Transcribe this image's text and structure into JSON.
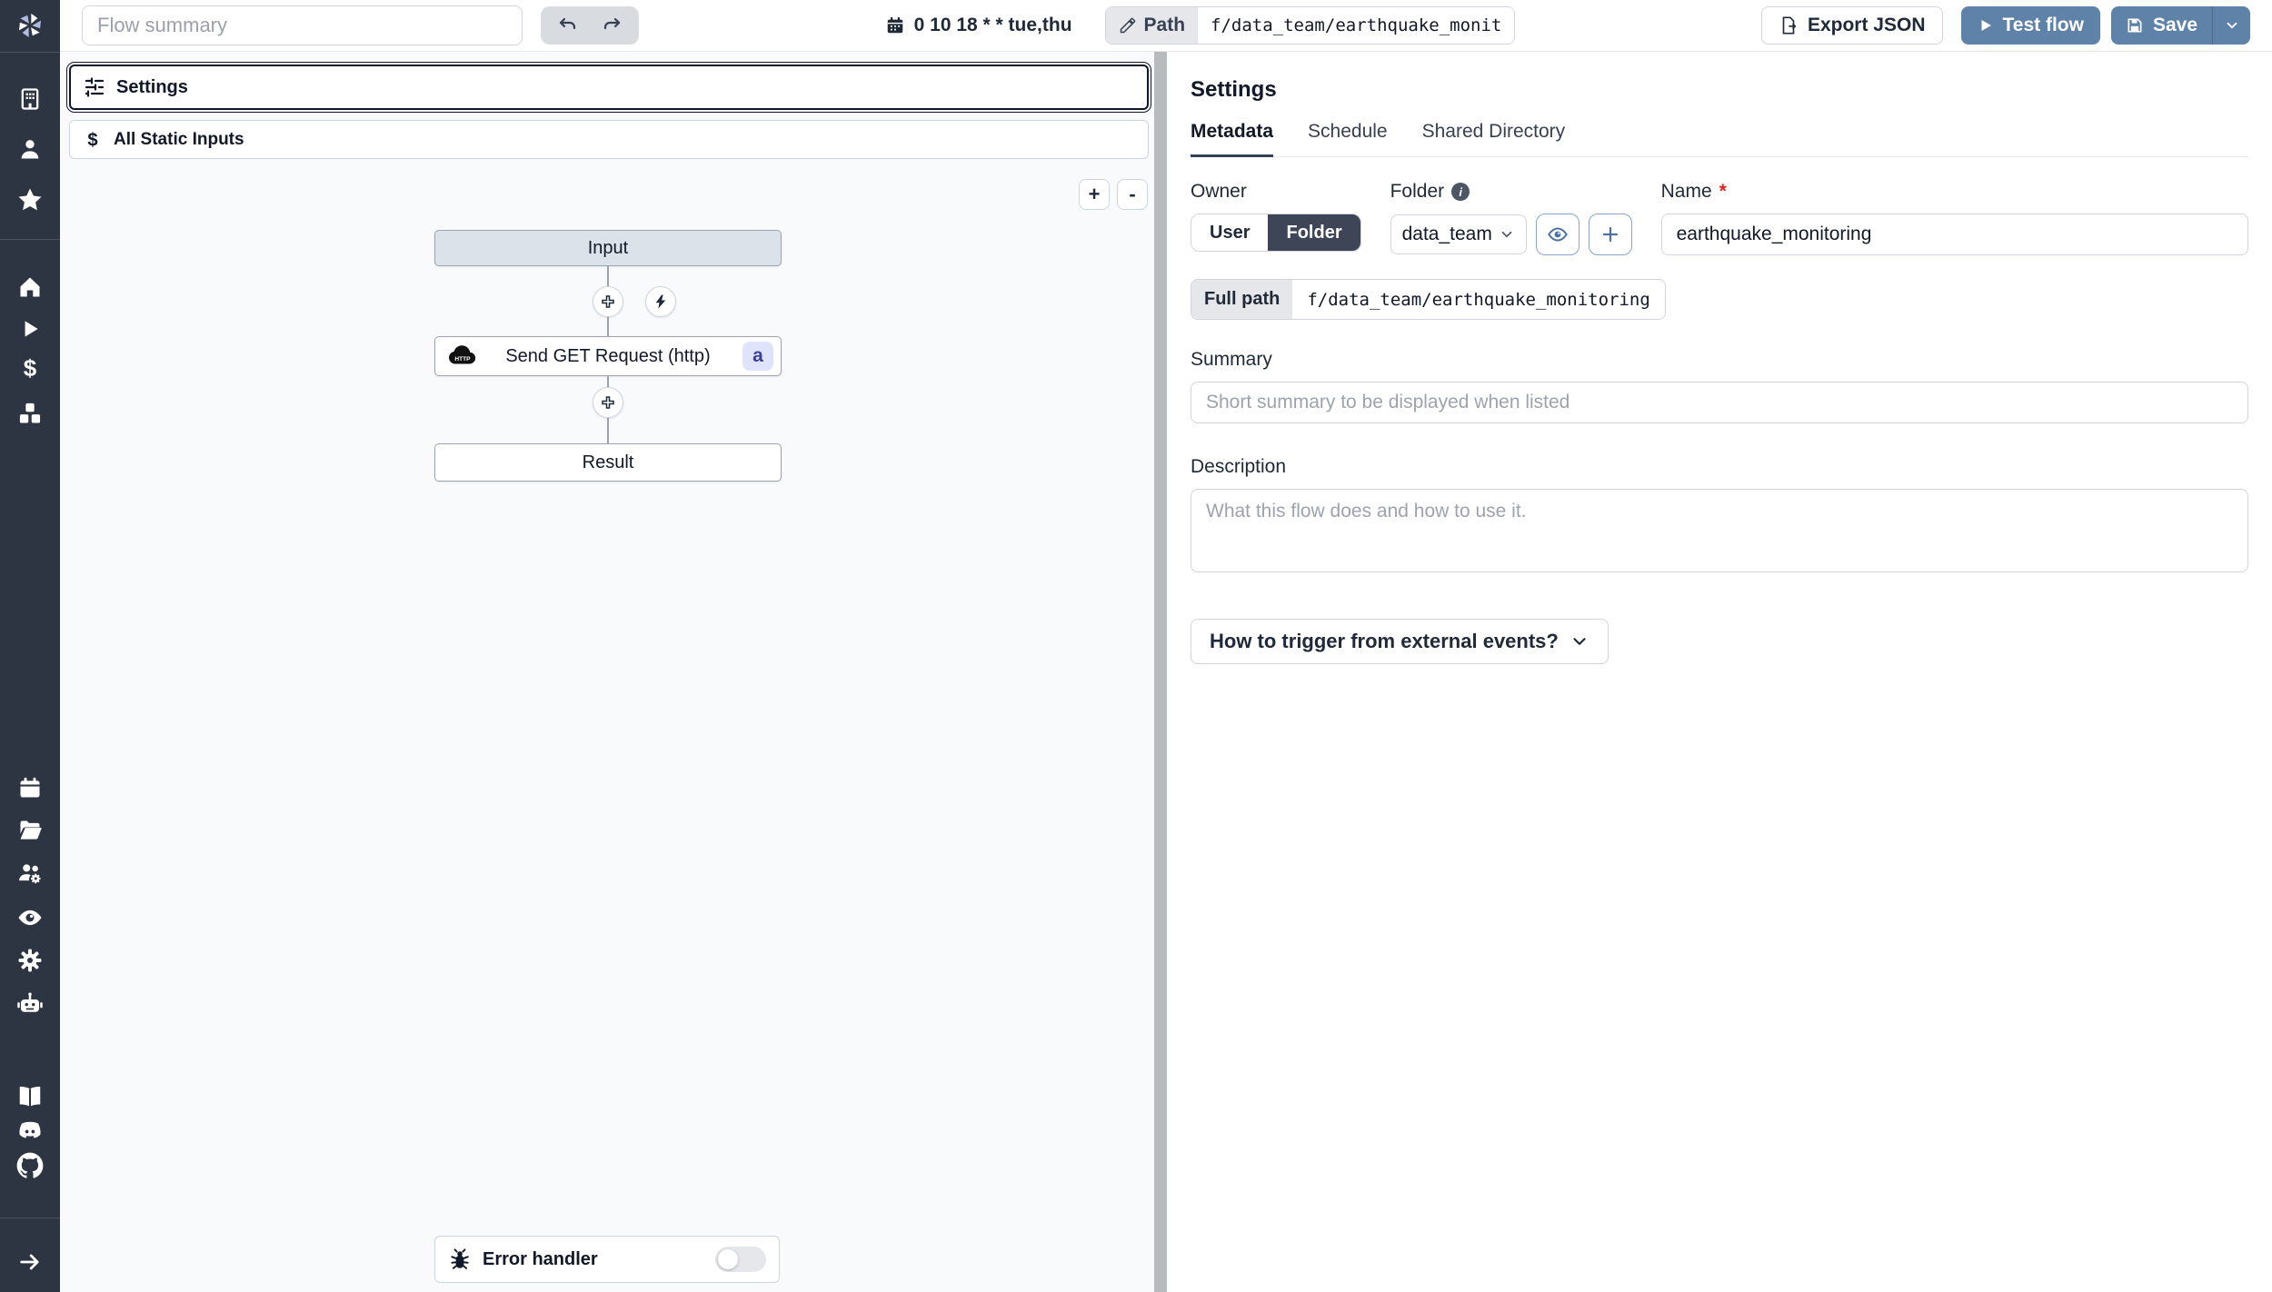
{
  "topbar": {
    "flow_summary_placeholder": "Flow summary",
    "schedule_cron": "0 10 18 * * tue,thu",
    "path_label": "Path",
    "path_value": "f/data_team/earthquake_monit",
    "export_json_label": "Export JSON",
    "test_flow_label": "Test flow",
    "save_label": "Save"
  },
  "sidebar": {
    "icons": [
      "windmill-logo",
      "workspace-building",
      "user",
      "favorites-star",
      "home",
      "runs-play",
      "variables-dollar",
      "resources-cubes",
      "schedules-calendar",
      "folders",
      "groups",
      "audit-eye",
      "workers-gear",
      "ai-robot",
      "docs-book",
      "discord",
      "github",
      "expand-arrow"
    ]
  },
  "flow_panel": {
    "settings_label": "Settings",
    "static_inputs_label": "All Static Inputs",
    "zoom_in_label": "+",
    "zoom_out_label": "-",
    "nodes": {
      "input_label": "Input",
      "http_label": "Send GET Request (http)",
      "http_badge": "a",
      "result_label": "Result"
    },
    "error_handler_label": "Error handler",
    "error_handler_enabled": false
  },
  "settings_panel": {
    "title": "Settings",
    "tabs": [
      "Metadata",
      "Schedule",
      "Shared Directory"
    ],
    "active_tab": "Metadata",
    "owner_label": "Owner",
    "owner_user_label": "User",
    "owner_folder_label": "Folder",
    "owner_selected": "Folder",
    "folder_label": "Folder",
    "folder_value": "data_team",
    "name_label": "Name",
    "name_required_mark": "*",
    "name_value": "earthquake_monitoring",
    "full_path_label": "Full path",
    "full_path_value": "f/data_team/earthquake_monitoring",
    "summary_label": "Summary",
    "summary_placeholder": "Short summary to be displayed when listed",
    "description_label": "Description",
    "description_placeholder": "What this flow does and how to use it.",
    "trigger_button_label": "How to trigger from external events?"
  },
  "colors": {
    "sidebar_bg": "#2e3542",
    "accent_blue": "#5e82a8",
    "canvas_bg": "#f8fafc",
    "badge_indigo_bg": "#dfe3fb",
    "badge_indigo_text": "#3b3f9e",
    "selected_border": "#0f172a"
  }
}
